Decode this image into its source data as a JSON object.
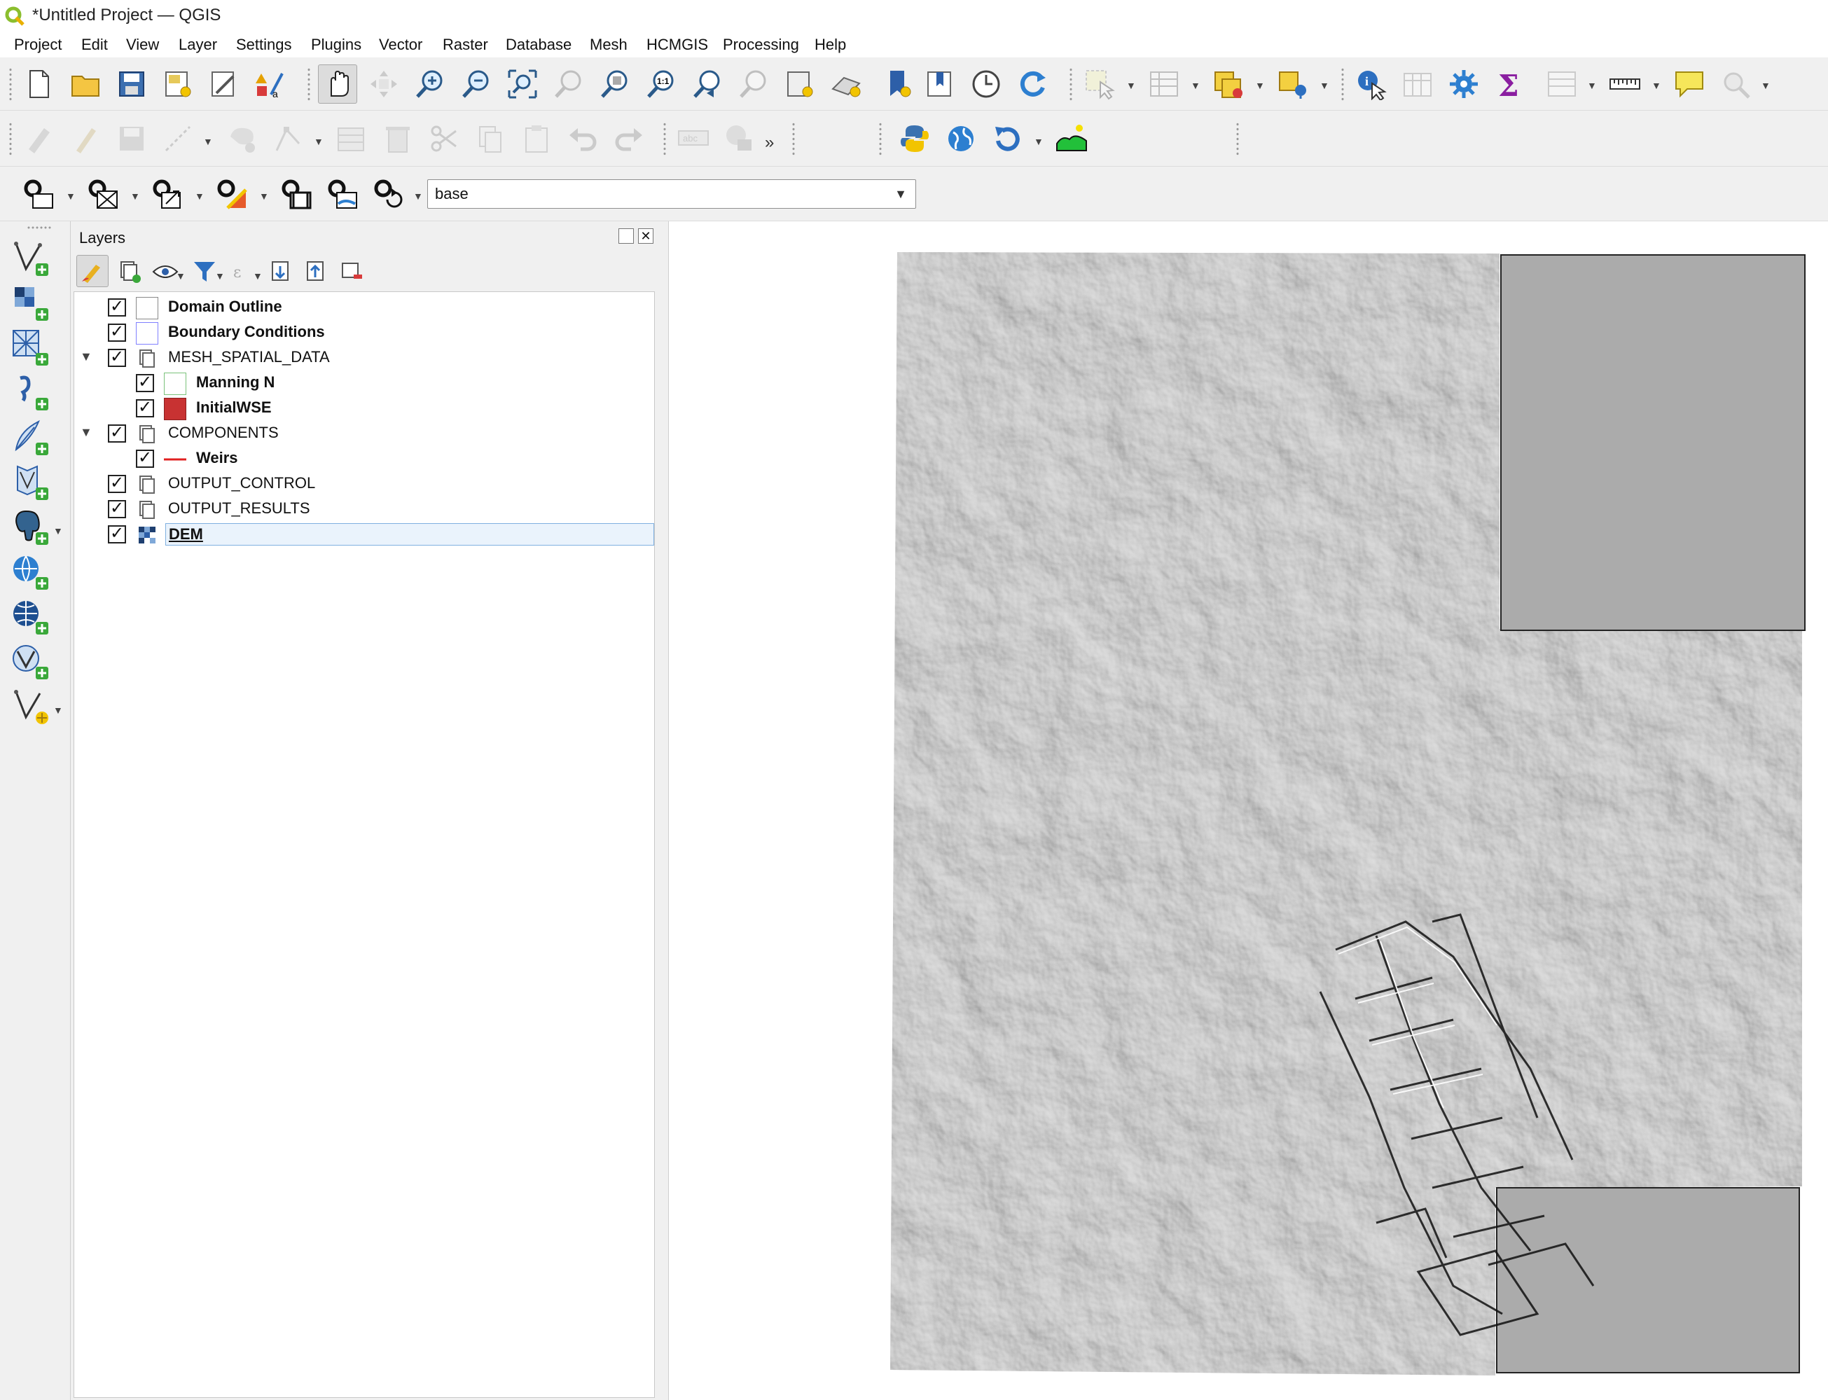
{
  "window": {
    "title": "*Untitled Project — QGIS"
  },
  "menu": [
    {
      "key": "project",
      "label": "Project"
    },
    {
      "key": "edit",
      "label": "Edit"
    },
    {
      "key": "view",
      "label": "View"
    },
    {
      "key": "layer",
      "label": "Layer"
    },
    {
      "key": "settings",
      "label": "Settings"
    },
    {
      "key": "plugins",
      "label": "Plugins"
    },
    {
      "key": "vector",
      "label": "Vector"
    },
    {
      "key": "raster",
      "label": "Raster"
    },
    {
      "key": "database",
      "label": "Database"
    },
    {
      "key": "mesh",
      "label": "Mesh"
    },
    {
      "key": "hcmgis",
      "label": "HCMGIS"
    },
    {
      "key": "processing",
      "label": "Processing"
    },
    {
      "key": "help",
      "label": "Help"
    }
  ],
  "toolbar": {
    "overflow_label": "»",
    "basemap_select": {
      "value": "base"
    }
  },
  "layers_panel": {
    "title": "Layers",
    "layers": [
      {
        "label": "Domain Outline",
        "checked": true,
        "bold": true,
        "symbol": "empty-fill",
        "color": "#ffffff",
        "indent": 0
      },
      {
        "label": "Boundary Conditions",
        "checked": true,
        "bold": true,
        "symbol": "blue-outline-fill",
        "color": "#8080ff",
        "indent": 0
      },
      {
        "label": "MESH_SPATIAL_DATA",
        "checked": true,
        "bold": false,
        "symbol": "group",
        "expanded": true,
        "indent": 0
      },
      {
        "label": "Manning N",
        "checked": true,
        "bold": true,
        "symbol": "green-outline-fill",
        "color": "#7ac27a",
        "indent": 1
      },
      {
        "label": "InitialWSE",
        "checked": true,
        "bold": true,
        "symbol": "red-fill",
        "color": "#c83232",
        "indent": 1
      },
      {
        "label": "COMPONENTS",
        "checked": true,
        "bold": false,
        "symbol": "group",
        "expanded": true,
        "indent": 0
      },
      {
        "label": "Weirs",
        "checked": true,
        "bold": true,
        "symbol": "red-line",
        "color": "#e02020",
        "indent": 1
      },
      {
        "label": "OUTPUT_CONTROL",
        "checked": true,
        "bold": false,
        "symbol": "group",
        "indent": 0
      },
      {
        "label": "OUTPUT_RESULTS",
        "checked": true,
        "bold": false,
        "symbol": "group",
        "indent": 0
      },
      {
        "label": "DEM",
        "checked": true,
        "bold": true,
        "symbol": "raster",
        "selected": true,
        "indent": 0
      }
    ]
  },
  "colors": {
    "accent": "#3c7fc4",
    "hillshade": "#b8b8b8",
    "nodata": "#ababab"
  }
}
